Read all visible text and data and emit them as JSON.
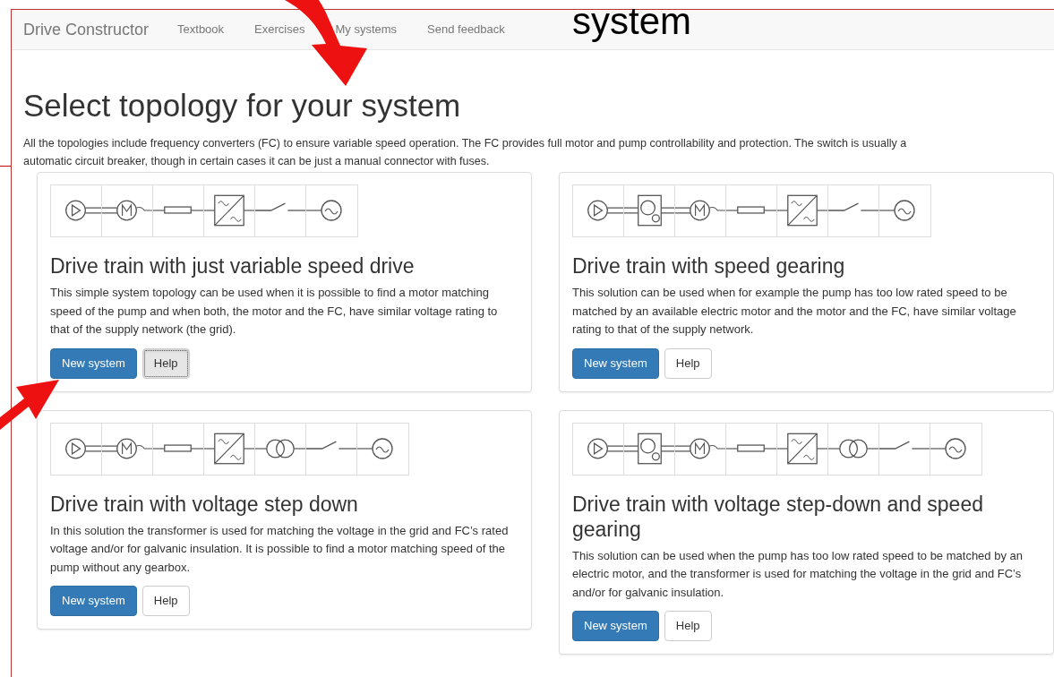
{
  "overlay_text": "system",
  "navbar": {
    "brand": "Drive Constructor",
    "links": [
      {
        "label": "Textbook"
      },
      {
        "label": "Exercises"
      },
      {
        "label": "My systems"
      },
      {
        "label": "Send feedback"
      }
    ]
  },
  "heading": "Select topology for your system",
  "intro_lines": [
    "All the topologies include frequency converters (FC) to ensure variable speed operation. The FC provides full motor and pump controllability and protection. The switch is usually a",
    "automatic circuit breaker, though in certain cases it can be just a manual connector with fuses."
  ],
  "cards": [
    {
      "components": [
        {
          "kind": "pump"
        },
        {
          "kind": "motor"
        },
        {
          "kind": "cable"
        },
        {
          "kind": "converter"
        },
        {
          "kind": "switch"
        },
        {
          "kind": "grid"
        }
      ],
      "title": "Drive train with just variable speed drive",
      "description": "This simple system topology can be used when it is possible to find a motor matching speed of the pump and when both, the motor and the FC, have similar voltage rating to that of the supply network (the grid).",
      "buttons": [
        {
          "label": "New system",
          "kind": "primary",
          "focused": false
        },
        {
          "label": "Help",
          "kind": "default",
          "focused": true
        }
      ]
    },
    {
      "components": [
        {
          "kind": "pump"
        },
        {
          "kind": "gearbox"
        },
        {
          "kind": "motor"
        },
        {
          "kind": "cable"
        },
        {
          "kind": "converter"
        },
        {
          "kind": "switch"
        },
        {
          "kind": "grid"
        }
      ],
      "title": "Drive train with speed gearing",
      "description": "This solution can be used when for example the pump has too low rated speed to be matched by an available electric motor and the motor and the FC, have similar voltage rating to that of the supply network.",
      "buttons": [
        {
          "label": "New system",
          "kind": "primary",
          "focused": false
        },
        {
          "label": "Help",
          "kind": "default",
          "focused": false
        }
      ]
    },
    {
      "components": [
        {
          "kind": "pump"
        },
        {
          "kind": "motor"
        },
        {
          "kind": "cable"
        },
        {
          "kind": "converter"
        },
        {
          "kind": "transformer"
        },
        {
          "kind": "switch"
        },
        {
          "kind": "grid"
        }
      ],
      "title": "Drive train with voltage step down",
      "description": "In this solution the transformer is used for matching the voltage in the grid and FC’s rated voltage and/or for galvanic insulation. It is possible to find a motor matching speed of the pump without any gearbox.",
      "buttons": [
        {
          "label": "New system",
          "kind": "primary",
          "focused": false
        },
        {
          "label": "Help",
          "kind": "default",
          "focused": false
        }
      ]
    },
    {
      "components": [
        {
          "kind": "pump"
        },
        {
          "kind": "gearbox"
        },
        {
          "kind": "motor"
        },
        {
          "kind": "cable"
        },
        {
          "kind": "converter"
        },
        {
          "kind": "transformer"
        },
        {
          "kind": "switch"
        },
        {
          "kind": "grid"
        }
      ],
      "title": "Drive train with voltage step-down and speed gearing",
      "description": "This solution can be used when the pump has too low rated speed to be matched by an electric motor, and the transformer is used for matching the voltage in the grid and FC’s and/or for galvanic insulation.",
      "buttons": [
        {
          "label": "New system",
          "kind": "primary",
          "focused": false
        },
        {
          "label": "Help",
          "kind": "default",
          "focused": false
        }
      ]
    }
  ]
}
